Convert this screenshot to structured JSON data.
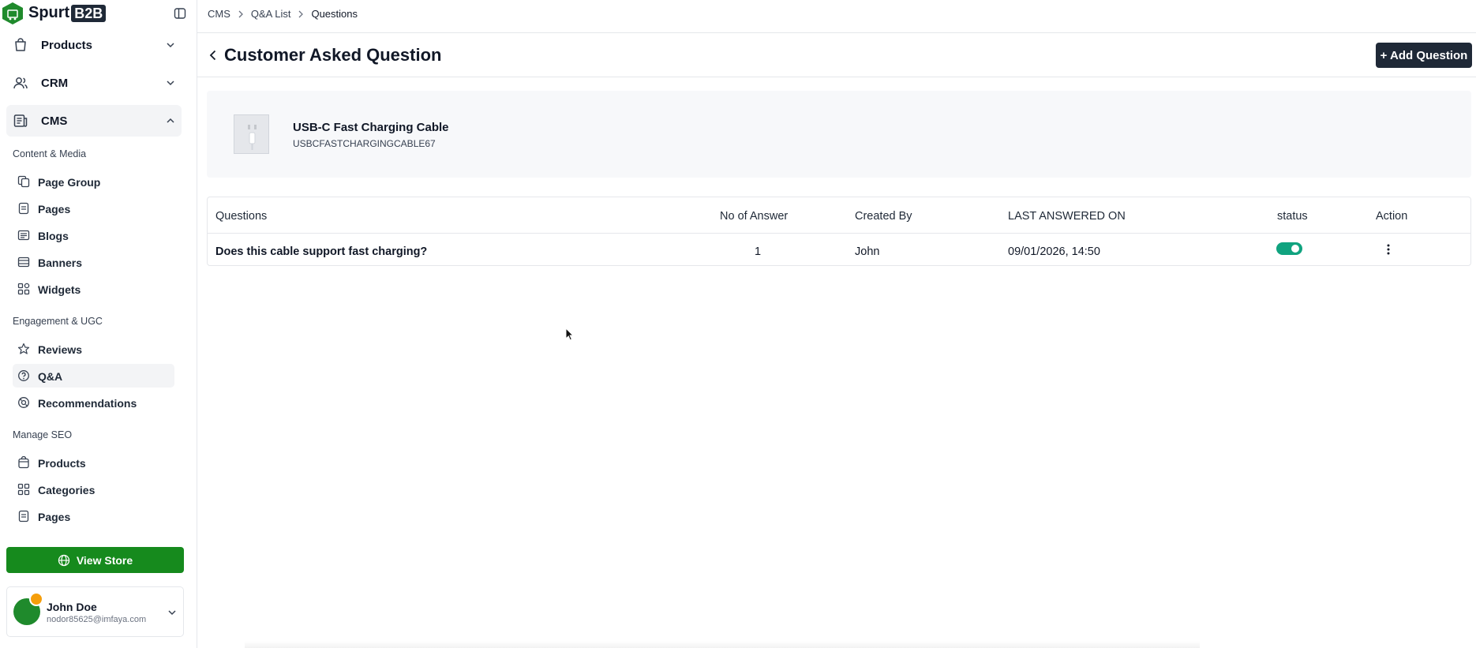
{
  "app": {
    "logo_text": "Spurt",
    "logo_badge": "B2B"
  },
  "sidebar": {
    "groups": [
      {
        "label": "Products",
        "icon": "shopping-bag-icon"
      },
      {
        "label": "CRM",
        "icon": "users-icon"
      },
      {
        "label": "CMS",
        "icon": "newspaper-icon"
      }
    ],
    "sections": [
      {
        "title": "Content & Media",
        "items": [
          {
            "label": "Page Group",
            "icon": "page-group-icon"
          },
          {
            "label": "Pages",
            "icon": "page-icon"
          },
          {
            "label": "Blogs",
            "icon": "blog-icon"
          },
          {
            "label": "Banners",
            "icon": "banner-icon"
          },
          {
            "label": "Widgets",
            "icon": "widgets-icon"
          }
        ]
      },
      {
        "title": "Engagement & UGC",
        "items": [
          {
            "label": "Reviews",
            "icon": "star-icon"
          },
          {
            "label": "Q&A",
            "icon": "question-circle-icon"
          },
          {
            "label": "Recommendations",
            "icon": "recommendations-icon"
          }
        ]
      },
      {
        "title": "Manage SEO",
        "items": [
          {
            "label": "Products",
            "icon": "package-icon"
          },
          {
            "label": "Categories",
            "icon": "grid-icon"
          },
          {
            "label": "Pages",
            "icon": "page-icon"
          }
        ]
      }
    ],
    "view_store_label": "View Store",
    "user": {
      "name": "John Doe",
      "email": "nodor85625@imfaya.com"
    }
  },
  "breadcrumb": [
    "CMS",
    "Q&A List",
    "Questions"
  ],
  "header": {
    "title": "Customer Asked Question",
    "add_button": "+ Add Question"
  },
  "product": {
    "name": "USB-C Fast Charging Cable",
    "sku": "USBCFASTCHARGINGCABLE67"
  },
  "table": {
    "columns": [
      "Questions",
      "No of Answer",
      "Created By",
      "LAST ANSWERED ON",
      "status",
      "Action"
    ],
    "rows": [
      {
        "question": "Does this cable support fast charging?",
        "answers": "1",
        "created_by": "John",
        "last_answered": "09/01/2026, 14:50",
        "status_on": true
      }
    ]
  },
  "colors": {
    "primary_green": "#168a1d",
    "toggle_on": "#10a37f",
    "dark_button": "#1f2937"
  }
}
